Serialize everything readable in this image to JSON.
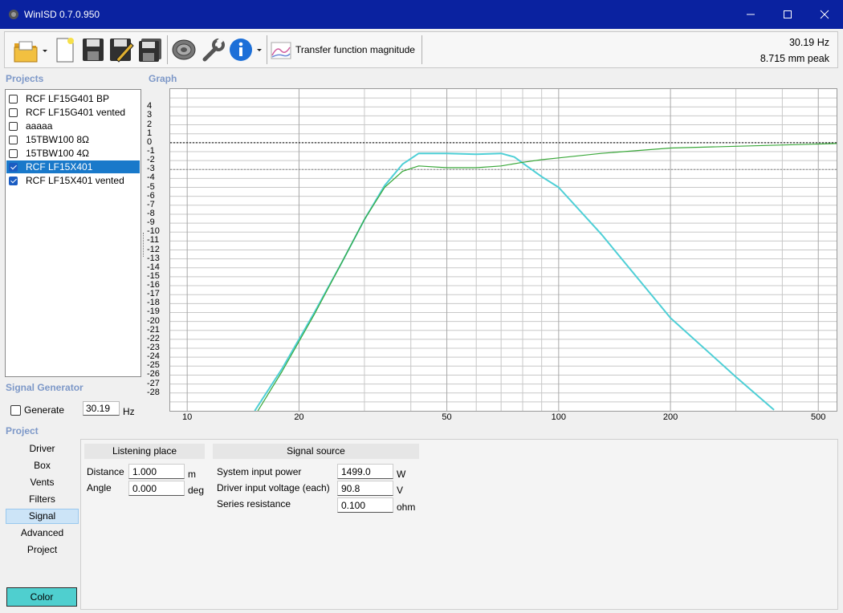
{
  "window": {
    "title": "WinISD 0.7.0.950"
  },
  "toolbar": {
    "graph_selector_label": "Transfer function magnitude",
    "status_frequency": "30.19 Hz",
    "status_excursion": "8.715 mm peak"
  },
  "sections": {
    "projects": "Projects",
    "graph": "Graph",
    "signal_generator": "Signal Generator",
    "project": "Project"
  },
  "projects": [
    {
      "name": "RCF  LF15G401 BP",
      "checked": false,
      "selected": false
    },
    {
      "name": "RCF  LF15G401 vented",
      "checked": false,
      "selected": false
    },
    {
      "name": "aaaaa",
      "checked": false,
      "selected": false
    },
    {
      "name": "15TBW100 8Ω",
      "checked": false,
      "selected": false
    },
    {
      "name": "15TBW100 4Ω",
      "checked": false,
      "selected": false
    },
    {
      "name": "RCF  LF15X401",
      "checked": true,
      "selected": true
    },
    {
      "name": "RCF  LF15X401 vented",
      "checked": true,
      "selected": false
    }
  ],
  "signal_generator": {
    "generate_label": "Generate",
    "generate_checked": false,
    "frequency": "30.19",
    "unit": "Hz"
  },
  "nav": {
    "items": [
      "Driver",
      "Box",
      "Vents",
      "Filters",
      "Signal",
      "Advanced",
      "Project"
    ],
    "selected": "Signal",
    "color_button": "Color"
  },
  "listening_place": {
    "header": "Listening place",
    "distance_label": "Distance",
    "distance_value": "1.000",
    "distance_unit": "m",
    "angle_label": "Angle",
    "angle_value": "0.000",
    "angle_unit": "deg"
  },
  "signal_source": {
    "header": "Signal source",
    "power_label": "System input power",
    "power_value": "1499.0",
    "power_unit": "W",
    "voltage_label": "Driver input voltage (each)",
    "voltage_value": "90.8",
    "voltage_unit": "V",
    "resistance_label": "Series resistance",
    "resistance_value": "0.100",
    "resistance_unit": "ohm"
  },
  "chart_data": {
    "type": "line",
    "x_scale": "log",
    "xlim": [
      9,
      560
    ],
    "ylim": [
      -30,
      6
    ],
    "x_ticks": [
      10,
      20,
      50,
      100,
      200,
      500
    ],
    "y_ticks": [
      4,
      3,
      2,
      1,
      0,
      -1,
      -2,
      -3,
      -4,
      -5,
      -6,
      -7,
      -8,
      -9,
      -10,
      -11,
      -12,
      -13,
      -14,
      -15,
      -16,
      -17,
      -18,
      -19,
      -20,
      -21,
      -22,
      -23,
      -24,
      -25,
      -26,
      -27,
      -28
    ],
    "reference_lines": [
      0,
      -3
    ],
    "grid": true,
    "series": [
      {
        "color": "#4ecfd6",
        "x": [
          15.2,
          18,
          22,
          26,
          30,
          34,
          38,
          42,
          50,
          60,
          70,
          76,
          82,
          90,
          100,
          130,
          200,
          300,
          380
        ],
        "y": [
          -30,
          -25.3,
          -19,
          -13.5,
          -8.6,
          -4.8,
          -2.4,
          -1.2,
          -1.2,
          -1.3,
          -1.2,
          -1.6,
          -2.6,
          -3.8,
          -5.0,
          -10.2,
          -19.6,
          -26.2,
          -29.9
        ]
      },
      {
        "color": "#3aa83a",
        "x": [
          15.5,
          18,
          22,
          26,
          30,
          34,
          38,
          42,
          50,
          60,
          70,
          80,
          90,
          100,
          130,
          200,
          300,
          500,
          560
        ],
        "y": [
          -30,
          -25.6,
          -19.2,
          -13.5,
          -8.6,
          -5.0,
          -3.2,
          -2.6,
          -2.8,
          -2.8,
          -2.6,
          -2.2,
          -1.9,
          -1.7,
          -1.2,
          -0.6,
          -0.4,
          -0.15,
          -0.1
        ]
      }
    ]
  }
}
